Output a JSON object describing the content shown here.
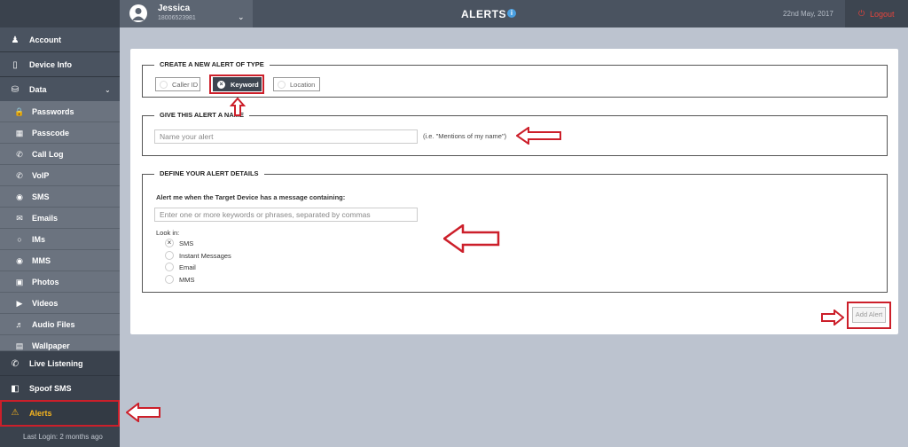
{
  "topbar": {
    "user_name": "Jessica",
    "user_phone": "18006523981",
    "title": "ALERTS",
    "info_symbol": "i",
    "date": "22nd May, 2017",
    "logout_label": "Logout"
  },
  "sidebar": {
    "main_items": [
      {
        "label": "Account",
        "icon": "user-icon"
      },
      {
        "label": "Device Info",
        "icon": "phone-icon"
      },
      {
        "label": "Data",
        "icon": "database-icon"
      }
    ],
    "data_items": [
      {
        "label": "Passwords",
        "icon": "lock-icon"
      },
      {
        "label": "Passcode",
        "icon": "keypad-icon"
      },
      {
        "label": "Call Log",
        "icon": "call-icon"
      },
      {
        "label": "VoIP",
        "icon": "voip-icon"
      },
      {
        "label": "SMS",
        "icon": "chat-bubble-icon"
      },
      {
        "label": "Emails",
        "icon": "envelope-icon"
      },
      {
        "label": "IMs",
        "icon": "im-icon"
      },
      {
        "label": "MMS",
        "icon": "mms-icon"
      },
      {
        "label": "Photos",
        "icon": "camera-icon"
      },
      {
        "label": "Videos",
        "icon": "video-icon"
      },
      {
        "label": "Audio Files",
        "icon": "speaker-icon"
      },
      {
        "label": "Wallpaper",
        "icon": "image-icon"
      }
    ],
    "bottom_items": [
      {
        "label": "Live Listening",
        "icon": "live-call-icon"
      },
      {
        "label": "Spoof SMS",
        "icon": "spoof-icon"
      },
      {
        "label": "Alerts",
        "icon": "warning-icon"
      }
    ],
    "last_login": "Last Login: 2 months ago",
    "active_color": "#f5b41f"
  },
  "alert_type": {
    "legend": "CREATE A NEW ALERT OF TYPE",
    "options": [
      {
        "label": "Caller ID",
        "selected": false
      },
      {
        "label": "Keyword",
        "selected": true
      },
      {
        "label": "Location",
        "selected": false
      }
    ]
  },
  "alert_name": {
    "legend": "GIVE THIS ALERT A NAME",
    "placeholder": "Name your alert",
    "hint": "(i.e. \"Mentions of my name\")"
  },
  "alert_details": {
    "legend": "DEFINE YOUR ALERT DETAILS",
    "prompt": "Alert me when the Target Device has a message containing:",
    "keywords_placeholder": "Enter one or more keywords or phrases, separated by commas",
    "look_in_label": "Look in:",
    "look_in_options": [
      {
        "label": "SMS",
        "checked": true
      },
      {
        "label": "Instant Messages",
        "checked": false
      },
      {
        "label": "Email",
        "checked": false
      },
      {
        "label": "MMS",
        "checked": false
      }
    ]
  },
  "add_alert_label": "Add Alert",
  "colors": {
    "highlight_red": "#cc1f2a",
    "logout_red": "#e8453c",
    "info_blue": "#4a9fe0"
  }
}
